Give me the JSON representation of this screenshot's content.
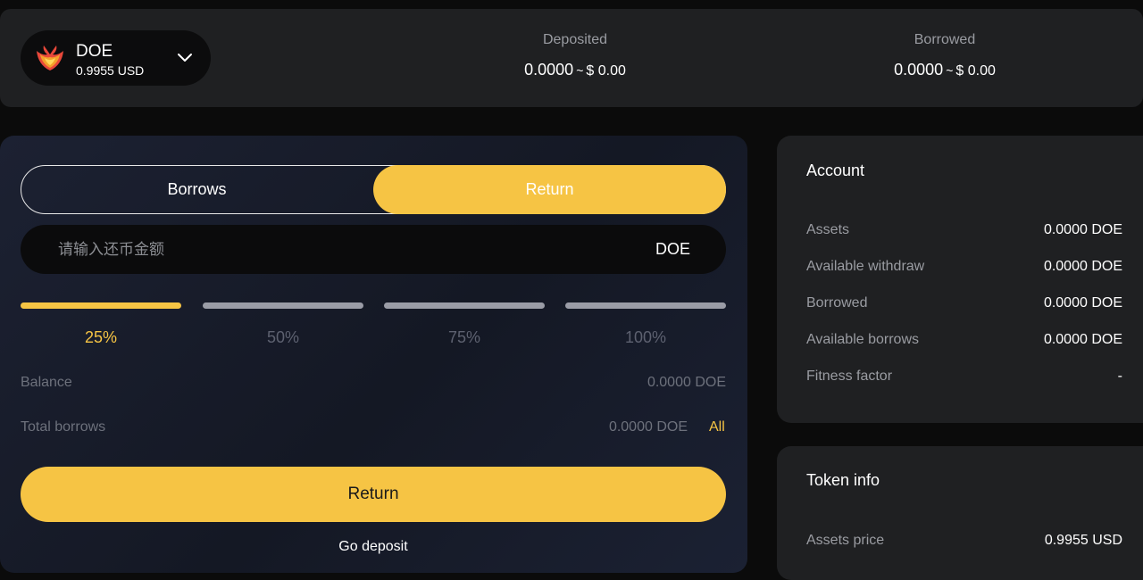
{
  "header": {
    "token": {
      "name": "DOE",
      "price": "0.9955 USD",
      "logo_icon": "phoenix-logo-icon"
    },
    "deposited": {
      "label": "Deposited",
      "amount": "0.0000",
      "approx": "~",
      "usd": "$ 0.00"
    },
    "borrowed": {
      "label": "Borrowed",
      "amount": "0.0000",
      "approx": "~",
      "usd": "$ 0.00"
    }
  },
  "form": {
    "tabs": [
      {
        "label": "Borrows",
        "active": false
      },
      {
        "label": "Return",
        "active": true
      }
    ],
    "amount_input": {
      "value": "",
      "placeholder": "请输入还币金额",
      "unit": "DOE"
    },
    "percentages": [
      {
        "label": "25%",
        "active": true
      },
      {
        "label": "50%",
        "active": false
      },
      {
        "label": "75%",
        "active": false
      },
      {
        "label": "100%",
        "active": false
      }
    ],
    "balance": {
      "label": "Balance",
      "value": "0.0000 DOE"
    },
    "total_borrows": {
      "label": "Total borrows",
      "value": "0.0000 DOE",
      "all_label": "All"
    },
    "submit_label": "Return",
    "go_deposit_label": "Go deposit"
  },
  "account": {
    "title": "Account",
    "rows": [
      {
        "label": "Assets",
        "value": "0.0000 DOE"
      },
      {
        "label": "Available withdraw",
        "value": "0.0000 DOE"
      },
      {
        "label": "Borrowed",
        "value": "0.0000 DOE"
      },
      {
        "label": "Available borrows",
        "value": "0.0000 DOE"
      },
      {
        "label": "Fitness factor",
        "value": "-"
      }
    ]
  },
  "token_info": {
    "title": "Token info",
    "rows": [
      {
        "label": "Assets price",
        "value": "0.9955 USD"
      }
    ]
  },
  "colors": {
    "accent": "#f6c444",
    "card_bg": "#1f2022",
    "page_bg": "#0b0b0b"
  }
}
